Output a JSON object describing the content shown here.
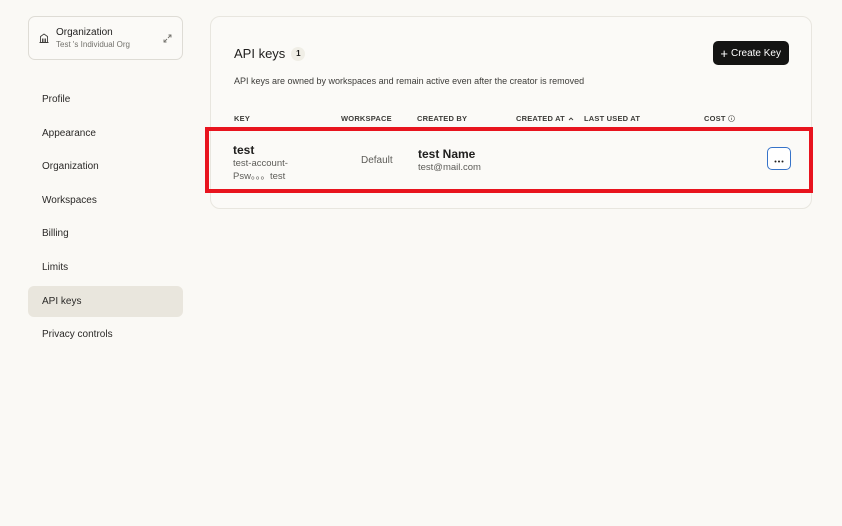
{
  "sidebar": {
    "org": {
      "name": "Organization",
      "subtitle": "Test 's Individual Org"
    },
    "items": [
      {
        "label": "Profile"
      },
      {
        "label": "Appearance"
      },
      {
        "label": "Organization"
      },
      {
        "label": "Workspaces"
      },
      {
        "label": "Billing"
      },
      {
        "label": "Limits"
      },
      {
        "label": "API keys",
        "active": true
      },
      {
        "label": "Privacy controls"
      }
    ]
  },
  "main": {
    "title": "API keys",
    "count": "1",
    "create_label": "Create Key",
    "description": "API keys are owned by workspaces and remain active even after the creator is removed",
    "columns": {
      "key": "KEY",
      "workspace": "WORKSPACE",
      "created_by": "CREATED BY",
      "created_at": "CREATED AT",
      "last_used_at": "LAST USED AT",
      "cost": "COST"
    },
    "rows": [
      {
        "key_name": "test",
        "key_value": "test-account-Psw。。。test",
        "workspace": "Default",
        "creator_name": "test Name",
        "creator_email": "test@mail.com"
      }
    ]
  },
  "colors": {
    "background": "#faf9f5",
    "accent_dark": "#141413",
    "highlight": "#e8141e",
    "focus_blue": "#3673c9"
  },
  "icons": {
    "org": "building-icon",
    "expand": "expand-arrows-icon",
    "plus": "plus-icon",
    "sort": "chevron-up-icon",
    "info": "info-icon",
    "more": "ellipsis-icon"
  }
}
